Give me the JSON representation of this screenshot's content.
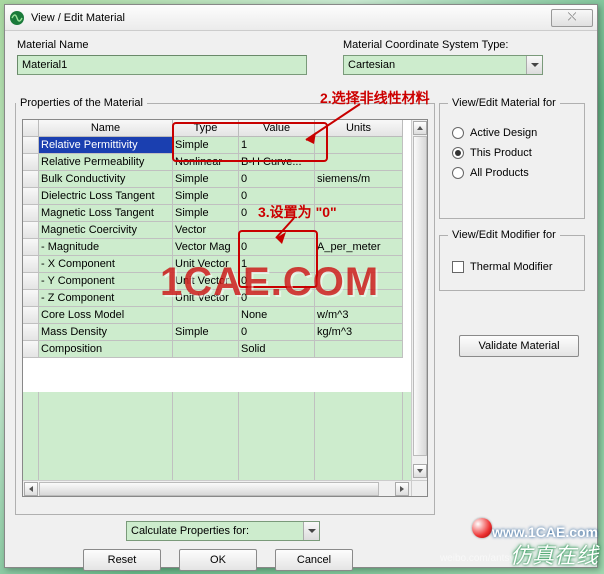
{
  "window": {
    "title": "View / Edit Material",
    "close_glyph": "⤬"
  },
  "material_name": {
    "label": "Material Name",
    "value": "Material1"
  },
  "coord_type": {
    "label": "Material Coordinate System Type:",
    "value": "Cartesian"
  },
  "props": {
    "legend": "Properties of the Material",
    "columns": {
      "blank": "",
      "name": "Name",
      "type": "Type",
      "value": "Value",
      "units": "Units"
    },
    "rows": [
      {
        "name": "Relative Permittivity",
        "type": "Simple",
        "value": "1",
        "units": ""
      },
      {
        "name": "Relative Permeability",
        "type": "Nonlinear",
        "value": "B-H Curve...",
        "units": ""
      },
      {
        "name": "Bulk Conductivity",
        "type": "Simple",
        "value": "0",
        "units": "siemens/m"
      },
      {
        "name": "Dielectric Loss Tangent",
        "type": "Simple",
        "value": "0",
        "units": ""
      },
      {
        "name": "Magnetic Loss Tangent",
        "type": "Simple",
        "value": "0",
        "units": ""
      },
      {
        "name": "Magnetic Coercivity",
        "type": "Vector",
        "value": "",
        "units": ""
      },
      {
        "name": "- Magnitude",
        "type": "Vector Mag",
        "value": "0",
        "units": "A_per_meter"
      },
      {
        "name": "- X Component",
        "type": "Unit Vector",
        "value": "1",
        "units": ""
      },
      {
        "name": "- Y Component",
        "type": "Unit Vector",
        "value": "0",
        "units": ""
      },
      {
        "name": "- Z Component",
        "type": "Unit Vector",
        "value": "0",
        "units": ""
      },
      {
        "name": "Core Loss Model",
        "type": "",
        "value": "None",
        "units": "w/m^3"
      },
      {
        "name": "Mass Density",
        "type": "Simple",
        "value": "0",
        "units": "kg/m^3"
      },
      {
        "name": "Composition",
        "type": "",
        "value": "Solid",
        "units": ""
      }
    ]
  },
  "view_edit_for": {
    "legend": "View/Edit Material for",
    "opts": {
      "active": "Active Design",
      "product": "This Product",
      "all": "All Products"
    },
    "selected": "product"
  },
  "modifier": {
    "legend": "View/Edit Modifier for",
    "thermal": "Thermal Modifier"
  },
  "validate_btn": "Validate Material",
  "calc_dd": {
    "label": "Calculate Properties for:"
  },
  "buttons": {
    "reset": "Reset",
    "ok": "OK",
    "cancel": "Cancel"
  },
  "annotations": {
    "a2": "2.选择非线性材料",
    "a3": "3.设置为 \"0\""
  },
  "watermarks": {
    "cae": "1CAE.COM",
    "url": "www.1CAE.com",
    "footer": "仿真在线",
    "weibo": "weibo.com/antsysch"
  }
}
